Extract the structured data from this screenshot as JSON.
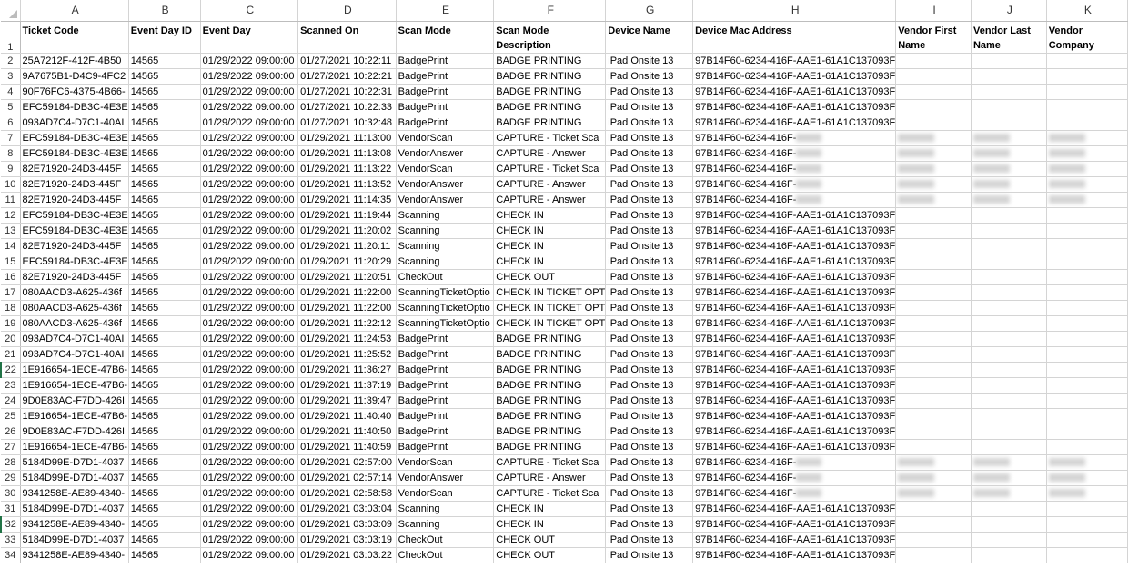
{
  "column_letters": [
    "A",
    "B",
    "C",
    "D",
    "E",
    "F",
    "G",
    "H",
    "I",
    "J",
    "K"
  ],
  "header_row_number": "1",
  "headers": [
    "Ticket Code",
    "Event Day ID",
    "Event Day",
    "Scanned On",
    "Scan Mode",
    "Scan Mode Description",
    "Device Name",
    "Device Mac Address",
    "Vendor First Name",
    "Vendor Last Name",
    "Vendor Company"
  ],
  "rows": [
    {
      "n": "2",
      "c": [
        "25A7212F-412F-4B50",
        "14565",
        "01/29/2022 09:00:00",
        "01/27/2021 10:22:11",
        "BadgePrint",
        "BADGE PRINTING",
        "iPad Onsite 13",
        "97B14F60-6234-416F-AAE1-61A1C137093F",
        "",
        "",
        ""
      ]
    },
    {
      "n": "3",
      "c": [
        "9A7675B1-D4C9-4FC2",
        "14565",
        "01/29/2022 09:00:00",
        "01/27/2021 10:22:21",
        "BadgePrint",
        "BADGE PRINTING",
        "iPad Onsite 13",
        "97B14F60-6234-416F-AAE1-61A1C137093F",
        "",
        "",
        ""
      ]
    },
    {
      "n": "4",
      "c": [
        "90F76FC6-4375-4B66-",
        "14565",
        "01/29/2022 09:00:00",
        "01/27/2021 10:22:31",
        "BadgePrint",
        "BADGE PRINTING",
        "iPad Onsite 13",
        "97B14F60-6234-416F-AAE1-61A1C137093F",
        "",
        "",
        ""
      ]
    },
    {
      "n": "5",
      "c": [
        "EFC59184-DB3C-4E3E",
        "14565",
        "01/29/2022 09:00:00",
        "01/27/2021 10:22:33",
        "BadgePrint",
        "BADGE PRINTING",
        "iPad Onsite 13",
        "97B14F60-6234-416F-AAE1-61A1C137093F",
        "",
        "",
        ""
      ]
    },
    {
      "n": "6",
      "c": [
        "093AD7C4-D7C1-40AI",
        "14565",
        "01/29/2022 09:00:00",
        "01/27/2021 10:32:48",
        "BadgePrint",
        "BADGE PRINTING",
        "iPad Onsite 13",
        "97B14F60-6234-416F-AAE1-61A1C137093F",
        "",
        "",
        ""
      ]
    },
    {
      "n": "7",
      "c": [
        "EFC59184-DB3C-4E3E",
        "14565",
        "01/29/2022 09:00:00",
        "01/29/2021 11:13:00",
        "VendorScan",
        "CAPTURE - Ticket Sca",
        "iPad Onsite 13",
        "97B14F60-6234-416F-",
        "",
        "",
        ""
      ],
      "blur": true
    },
    {
      "n": "8",
      "c": [
        "EFC59184-DB3C-4E3E",
        "14565",
        "01/29/2022 09:00:00",
        "01/29/2021 11:13:08",
        "VendorAnswer",
        "CAPTURE - Answer",
        "iPad Onsite 13",
        "97B14F60-6234-416F-",
        "",
        "",
        ""
      ],
      "blur": true
    },
    {
      "n": "9",
      "c": [
        "82E71920-24D3-445F",
        "14565",
        "01/29/2022 09:00:00",
        "01/29/2021 11:13:22",
        "VendorScan",
        "CAPTURE - Ticket Sca",
        "iPad Onsite 13",
        "97B14F60-6234-416F-",
        "",
        "",
        ""
      ],
      "blur": true
    },
    {
      "n": "10",
      "c": [
        "82E71920-24D3-445F",
        "14565",
        "01/29/2022 09:00:00",
        "01/29/2021 11:13:52",
        "VendorAnswer",
        "CAPTURE - Answer",
        "iPad Onsite 13",
        "97B14F60-6234-416F-",
        "",
        "",
        ""
      ],
      "blur": true
    },
    {
      "n": "11",
      "c": [
        "82E71920-24D3-445F",
        "14565",
        "01/29/2022 09:00:00",
        "01/29/2021 11:14:35",
        "VendorAnswer",
        "CAPTURE - Answer",
        "iPad Onsite 13",
        "97B14F60-6234-416F-",
        "",
        "",
        ""
      ],
      "blur": true
    },
    {
      "n": "12",
      "c": [
        "EFC59184-DB3C-4E3E",
        "14565",
        "01/29/2022 09:00:00",
        "01/29/2021 11:19:44",
        "Scanning",
        "CHECK IN",
        "iPad Onsite 13",
        "97B14F60-6234-416F-AAE1-61A1C137093F",
        "",
        "",
        ""
      ]
    },
    {
      "n": "13",
      "c": [
        "EFC59184-DB3C-4E3E",
        "14565",
        "01/29/2022 09:00:00",
        "01/29/2021 11:20:02",
        "Scanning",
        "CHECK IN",
        "iPad Onsite 13",
        "97B14F60-6234-416F-AAE1-61A1C137093F",
        "",
        "",
        ""
      ]
    },
    {
      "n": "14",
      "c": [
        "82E71920-24D3-445F",
        "14565",
        "01/29/2022 09:00:00",
        "01/29/2021 11:20:11",
        "Scanning",
        "CHECK IN",
        "iPad Onsite 13",
        "97B14F60-6234-416F-AAE1-61A1C137093F",
        "",
        "",
        ""
      ]
    },
    {
      "n": "15",
      "c": [
        "EFC59184-DB3C-4E3E",
        "14565",
        "01/29/2022 09:00:00",
        "01/29/2021 11:20:29",
        "Scanning",
        "CHECK IN",
        "iPad Onsite 13",
        "97B14F60-6234-416F-AAE1-61A1C137093F",
        "",
        "",
        ""
      ]
    },
    {
      "n": "16",
      "c": [
        "82E71920-24D3-445F",
        "14565",
        "01/29/2022 09:00:00",
        "01/29/2021 11:20:51",
        "CheckOut",
        "CHECK OUT",
        "iPad Onsite 13",
        "97B14F60-6234-416F-AAE1-61A1C137093F",
        "",
        "",
        ""
      ]
    },
    {
      "n": "17",
      "c": [
        "080AACD3-A625-436f",
        "14565",
        "01/29/2022 09:00:00",
        "01/29/2021 11:22:00",
        "ScanningTicketOptio",
        "CHECK IN TICKET OPT",
        "iPad Onsite 13",
        "97B14F60-6234-416F-AAE1-61A1C137093F",
        "",
        "",
        ""
      ]
    },
    {
      "n": "18",
      "c": [
        "080AACD3-A625-436f",
        "14565",
        "01/29/2022 09:00:00",
        "01/29/2021 11:22:00",
        "ScanningTicketOptio",
        "CHECK IN TICKET OPT",
        "iPad Onsite 13",
        "97B14F60-6234-416F-AAE1-61A1C137093F",
        "",
        "",
        ""
      ]
    },
    {
      "n": "19",
      "c": [
        "080AACD3-A625-436f",
        "14565",
        "01/29/2022 09:00:00",
        "01/29/2021 11:22:12",
        "ScanningTicketOptio",
        "CHECK IN TICKET OPT",
        "iPad Onsite 13",
        "97B14F60-6234-416F-AAE1-61A1C137093F",
        "",
        "",
        ""
      ]
    },
    {
      "n": "20",
      "c": [
        "093AD7C4-D7C1-40AI",
        "14565",
        "01/29/2022 09:00:00",
        "01/29/2021 11:24:53",
        "BadgePrint",
        "BADGE PRINTING",
        "iPad Onsite 13",
        "97B14F60-6234-416F-AAE1-61A1C137093F",
        "",
        "",
        ""
      ]
    },
    {
      "n": "21",
      "c": [
        "093AD7C4-D7C1-40AI",
        "14565",
        "01/29/2022 09:00:00",
        "01/29/2021 11:25:52",
        "BadgePrint",
        "BADGE PRINTING",
        "iPad Onsite 13",
        "97B14F60-6234-416F-AAE1-61A1C137093F",
        "",
        "",
        ""
      ]
    },
    {
      "n": "22",
      "c": [
        "1E916654-1ECE-47B6-",
        "14565",
        "01/29/2022 09:00:00",
        "01/29/2021 11:36:27",
        "BadgePrint",
        "BADGE PRINTING",
        "iPad Onsite 13",
        "97B14F60-6234-416F-AAE1-61A1C137093F",
        "",
        "",
        ""
      ],
      "sel": true
    },
    {
      "n": "23",
      "c": [
        "1E916654-1ECE-47B6-",
        "14565",
        "01/29/2022 09:00:00",
        "01/29/2021 11:37:19",
        "BadgePrint",
        "BADGE PRINTING",
        "iPad Onsite 13",
        "97B14F60-6234-416F-AAE1-61A1C137093F",
        "",
        "",
        ""
      ]
    },
    {
      "n": "24",
      "c": [
        "9D0E83AC-F7DD-426I",
        "14565",
        "01/29/2022 09:00:00",
        "01/29/2021 11:39:47",
        "BadgePrint",
        "BADGE PRINTING",
        "iPad Onsite 13",
        "97B14F60-6234-416F-AAE1-61A1C137093F",
        "",
        "",
        ""
      ]
    },
    {
      "n": "25",
      "c": [
        "1E916654-1ECE-47B6-",
        "14565",
        "01/29/2022 09:00:00",
        "01/29/2021 11:40:40",
        "BadgePrint",
        "BADGE PRINTING",
        "iPad Onsite 13",
        "97B14F60-6234-416F-AAE1-61A1C137093F",
        "",
        "",
        ""
      ]
    },
    {
      "n": "26",
      "c": [
        "9D0E83AC-F7DD-426I",
        "14565",
        "01/29/2022 09:00:00",
        "01/29/2021 11:40:50",
        "BadgePrint",
        "BADGE PRINTING",
        "iPad Onsite 13",
        "97B14F60-6234-416F-AAE1-61A1C137093F",
        "",
        "",
        ""
      ]
    },
    {
      "n": "27",
      "c": [
        "1E916654-1ECE-47B6-",
        "14565",
        "01/29/2022 09:00:00",
        "01/29/2021 11:40:59",
        "BadgePrint",
        "BADGE PRINTING",
        "iPad Onsite 13",
        "97B14F60-6234-416F-AAE1-61A1C137093F",
        "",
        "",
        ""
      ]
    },
    {
      "n": "28",
      "c": [
        "5184D99E-D7D1-4037",
        "14565",
        "01/29/2022 09:00:00",
        "01/29/2021 02:57:00",
        "VendorScan",
        "CAPTURE - Ticket Sca",
        "iPad Onsite 13",
        "97B14F60-6234-416F-",
        "",
        "",
        ""
      ],
      "blur": true
    },
    {
      "n": "29",
      "c": [
        "5184D99E-D7D1-4037",
        "14565",
        "01/29/2022 09:00:00",
        "01/29/2021 02:57:14",
        "VendorAnswer",
        "CAPTURE - Answer",
        "iPad Onsite 13",
        "97B14F60-6234-416F-",
        "",
        "",
        ""
      ],
      "blur": true
    },
    {
      "n": "30",
      "c": [
        "9341258E-AE89-4340-",
        "14565",
        "01/29/2022 09:00:00",
        "01/29/2021 02:58:58",
        "VendorScan",
        "CAPTURE - Ticket Sca",
        "iPad Onsite 13",
        "97B14F60-6234-416F-",
        "",
        "",
        ""
      ],
      "blur": true
    },
    {
      "n": "31",
      "c": [
        "5184D99E-D7D1-4037",
        "14565",
        "01/29/2022 09:00:00",
        "01/29/2021 03:03:04",
        "Scanning",
        "CHECK IN",
        "iPad Onsite 13",
        "97B14F60-6234-416F-AAE1-61A1C137093F",
        "",
        "",
        ""
      ]
    },
    {
      "n": "32",
      "c": [
        "9341258E-AE89-4340-",
        "14565",
        "01/29/2022 09:00:00",
        "01/29/2021 03:03:09",
        "Scanning",
        "CHECK IN",
        "iPad Onsite 13",
        "97B14F60-6234-416F-AAE1-61A1C137093F",
        "",
        "",
        ""
      ],
      "sel": true
    },
    {
      "n": "33",
      "c": [
        "5184D99E-D7D1-4037",
        "14565",
        "01/29/2022 09:00:00",
        "01/29/2021 03:03:19",
        "CheckOut",
        "CHECK OUT",
        "iPad Onsite 13",
        "97B14F60-6234-416F-AAE1-61A1C137093F",
        "",
        "",
        ""
      ]
    },
    {
      "n": "34",
      "c": [
        "9341258E-AE89-4340-",
        "14565",
        "01/29/2022 09:00:00",
        "01/29/2021 03:03:22",
        "CheckOut",
        "CHECK OUT",
        "iPad Onsite 13",
        "97B14F60-6234-416F-AAE1-61A1C137093F",
        "",
        "",
        ""
      ]
    }
  ]
}
